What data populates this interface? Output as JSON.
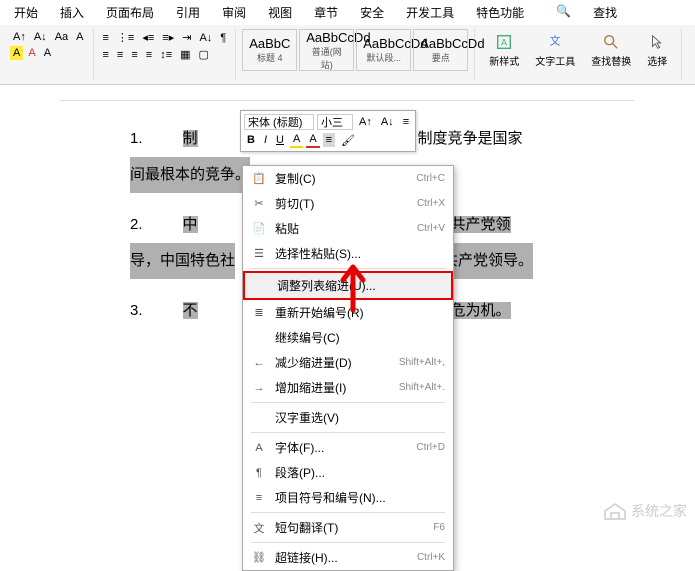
{
  "tabs": [
    "开始",
    "插入",
    "页面布局",
    "引用",
    "审阅",
    "视图",
    "章节",
    "安全",
    "开发工具",
    "特色功能"
  ],
  "search_placeholder": "查找",
  "styles": [
    {
      "preview": "AaBbC",
      "name": "标题 4"
    },
    {
      "preview": "AaBbCcDd",
      "name": "普通(网站)"
    },
    {
      "preview": "AaBbCcDd",
      "name": "默认段..."
    },
    {
      "preview": "AaBbCcDd",
      "name": "要点"
    }
  ],
  "actions": {
    "new_style": "新样式",
    "text_tools": "文字工具",
    "find_replace": "查找替换",
    "select": "选择"
  },
  "float": {
    "font": "宋体 (标题)",
    "size": "小三"
  },
  "doc": {
    "l1_num": "1.",
    "l1a": "制",
    "l1b": "的优势，制度竞争是国家",
    "l2": "间最根本的竞争。",
    "l3_num": "2.",
    "l3a": "中",
    "l3b": "是中国共产党领",
    "l4a": "导，中国特色社",
    "l4b": "共产党领导。",
    "l5_num": "3.",
    "l5a": "不",
    "l5b": "防控化危为机。"
  },
  "menu": [
    {
      "icon": "📋",
      "label": "复制(C)",
      "shortcut": "Ctrl+C"
    },
    {
      "icon": "✂",
      "label": "剪切(T)",
      "shortcut": "Ctrl+X"
    },
    {
      "icon": "📄",
      "label": "粘贴",
      "shortcut": "Ctrl+V"
    },
    {
      "icon": "☰",
      "label": "选择性粘贴(S)...",
      "shortcut": ""
    },
    {
      "sep": true
    },
    {
      "icon": "",
      "label": "调整列表缩进(U)...",
      "shortcut": "",
      "highlight": true
    },
    {
      "icon": "≣",
      "label": "重新开始编号(R)",
      "shortcut": ""
    },
    {
      "icon": "",
      "label": "继续编号(C)",
      "shortcut": ""
    },
    {
      "icon": "←",
      "label": "减少缩进量(D)",
      "shortcut": "Shift+Alt+,"
    },
    {
      "icon": "→",
      "label": "增加缩进量(I)",
      "shortcut": "Shift+Alt+."
    },
    {
      "sep": true
    },
    {
      "icon": "",
      "label": "汉字重选(V)",
      "shortcut": ""
    },
    {
      "sep": true
    },
    {
      "icon": "A",
      "label": "字体(F)...",
      "shortcut": "Ctrl+D"
    },
    {
      "icon": "¶",
      "label": "段落(P)...",
      "shortcut": ""
    },
    {
      "icon": "≡",
      "label": "项目符号和编号(N)...",
      "shortcut": ""
    },
    {
      "sep": true
    },
    {
      "icon": "文",
      "label": "短句翻译(T)",
      "shortcut": "F6"
    },
    {
      "sep": true
    },
    {
      "icon": "⛓",
      "label": "超链接(H)...",
      "shortcut": "Ctrl+K"
    }
  ],
  "watermark": "系统之家"
}
